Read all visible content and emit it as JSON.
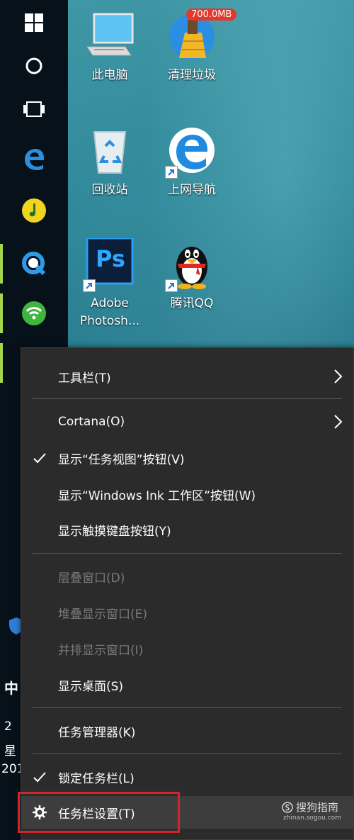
{
  "desktop": {
    "icons": [
      {
        "label": "此电脑",
        "icon": "this-pc-icon"
      },
      {
        "label": "清理垃圾",
        "icon": "broom-icon",
        "badge": "700.0MB"
      },
      {
        "label": "回收站",
        "icon": "recycle-bin-icon"
      },
      {
        "label": "上网导航",
        "icon": "ie-icon"
      },
      {
        "label": "Adobe Photosh...",
        "icon": "photoshop-icon",
        "inner": "Ps"
      },
      {
        "label": "腾讯QQ",
        "icon": "qq-penguin-icon"
      }
    ]
  },
  "taskbar": {
    "buttons": [
      "windows-start-icon",
      "cortana-icon",
      "task-view-icon",
      "edge-icon",
      "music-icon",
      "browser-q-icon",
      "wifi-icon"
    ],
    "side_fragments": {
      "clock_char": "中",
      "date_a": "2",
      "date_b": "星",
      "date_c": "201"
    }
  },
  "menu": {
    "items": [
      {
        "label": "工具栏(T)",
        "submenu": true
      },
      {
        "label": "Cortana(O)",
        "submenu": true
      },
      {
        "label": "显示“任务视图”按钮(V)",
        "checked": true
      },
      {
        "label": "显示“Windows Ink 工作区”按钮(W)"
      },
      {
        "label": "显示触摸键盘按钮(Y)"
      },
      {
        "label": "层叠窗口(D)",
        "disabled": true
      },
      {
        "label": "堆叠显示窗口(E)",
        "disabled": true
      },
      {
        "label": "并排显示窗口(I)",
        "disabled": true
      },
      {
        "label": "显示桌面(S)"
      },
      {
        "label": "任务管理器(K)"
      },
      {
        "label": "锁定任务栏(L)",
        "checked": true
      },
      {
        "label": "任务栏设置(T)",
        "icon": "gear-icon"
      }
    ]
  },
  "watermark": {
    "text": "搜狗指南",
    "sub": "zhinan.sogou.com"
  },
  "colors": {
    "highlight": "#d2252a",
    "active_indicator": "#a5d64c",
    "menu_bg": "#2b2b2b"
  }
}
